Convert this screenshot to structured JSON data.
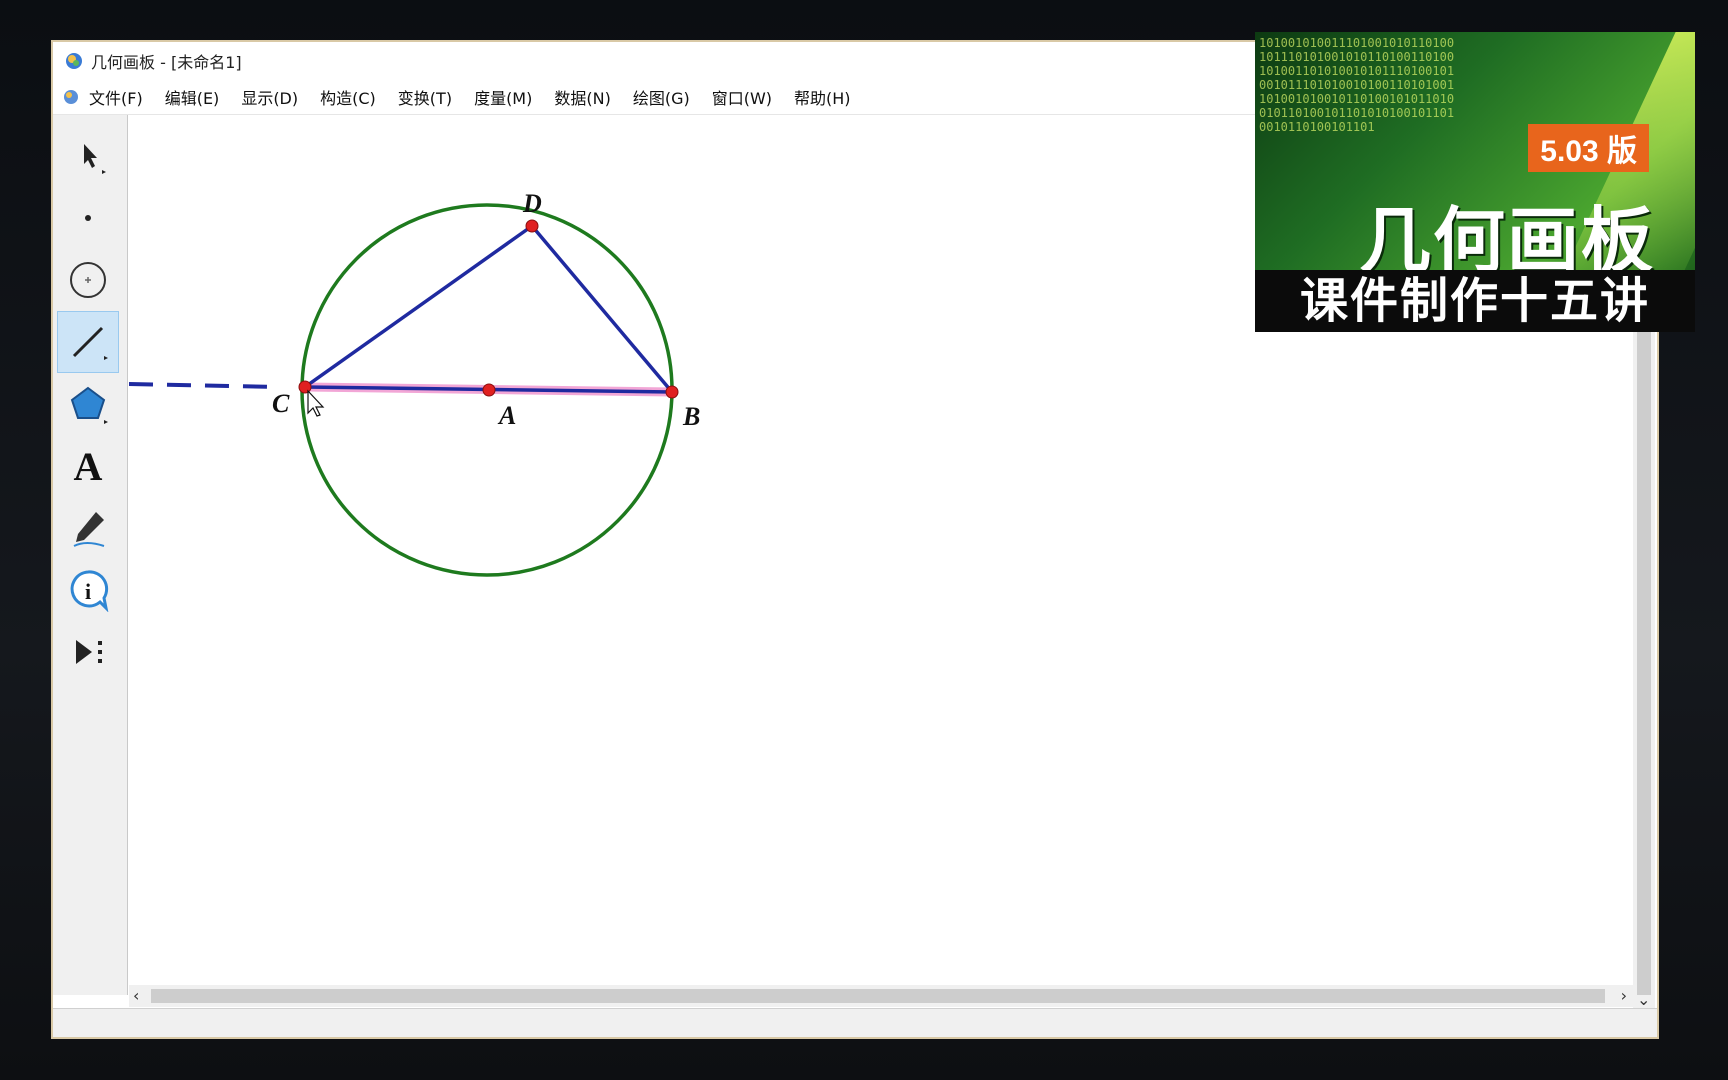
{
  "window": {
    "title": "几何画板 - [未命名1]"
  },
  "menu": [
    "文件(F)",
    "编辑(E)",
    "显示(D)",
    "构造(C)",
    "变换(T)",
    "度量(M)",
    "数据(N)",
    "绘图(G)",
    "窗口(W)",
    "帮助(H)"
  ],
  "tools": [
    {
      "name": "arrow-tool-icon"
    },
    {
      "name": "point-tool-icon"
    },
    {
      "name": "compass-tool-icon"
    },
    {
      "name": "straightedge-tool-icon",
      "selected": true
    },
    {
      "name": "polygon-tool-icon"
    },
    {
      "name": "text-tool-icon",
      "glyph": "A"
    },
    {
      "name": "marker-tool-icon"
    },
    {
      "name": "information-tool-icon"
    },
    {
      "name": "custom-tool-icon"
    }
  ],
  "geometry": {
    "labels": {
      "D": "D",
      "C": "C",
      "A": "A",
      "B": "B"
    },
    "colors": {
      "circle": "#1e7a1e",
      "segments": "#1f2aa0",
      "points": "#e02020",
      "highlight": "#f2a6d6"
    }
  },
  "banner": {
    "version": "5.03 版",
    "title": "几何画板",
    "subtitle": "课件制作十五讲"
  },
  "scroll": {
    "left": "‹",
    "right": "›",
    "down": "⌄"
  }
}
